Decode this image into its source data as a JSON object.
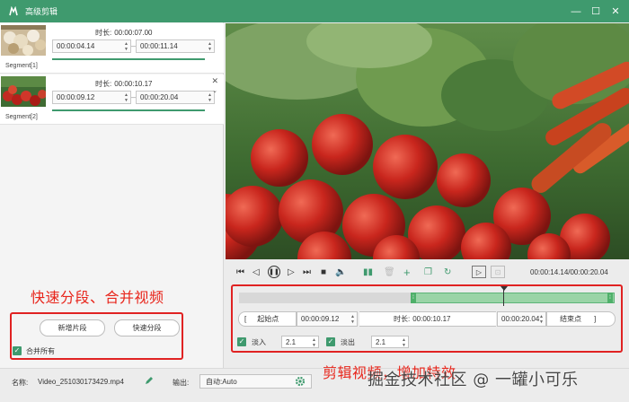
{
  "window": {
    "title": "高级剪辑",
    "controls": {
      "minimize": "—",
      "maximize": "☐",
      "close": "✕"
    }
  },
  "segments": [
    {
      "label": "Segment[1]",
      "duration_label": "时长:",
      "duration": "00:00:07.00",
      "start": "00:00:04.14",
      "end": "00:00:11.14"
    },
    {
      "label": "Segment[2]",
      "duration_label": "时长:",
      "duration": "00:00:10.17",
      "start": "00:00:09.12",
      "end": "00:00:20.04"
    }
  ],
  "segment_ui": {
    "close": "✕",
    "collapse": "⌄",
    "dash": "—"
  },
  "left_actions": {
    "add_segment": "新增片段",
    "quick_split": "快速分段",
    "merge_all": "合并所有",
    "merge_all_checked": true
  },
  "annotations": {
    "left": "快速分段、合并视频",
    "bottom": "剪辑视频，增加特效",
    "watermark": "掘金技术社区 @ 一罐小可乐"
  },
  "player": {
    "timecode": "00:00:14.14/00:00:20.04"
  },
  "trim": {
    "start_label": "起始点",
    "start_bracket": "[",
    "start": "00:00:09.12",
    "duration_label": "时长:",
    "duration": "00:00:10.17",
    "end": "00:00:20.04",
    "end_label": "结束点",
    "end_bracket": "]",
    "selection_start": 0.465,
    "selection_end": 1.0,
    "playhead": 0.7
  },
  "fade": {
    "in_label": "淡入",
    "in_value": "2.1",
    "out_label": "淡出",
    "out_value": "2.1",
    "in_checked": true,
    "out_checked": true
  },
  "bottom": {
    "name_label": "名称:",
    "file_name": "Video_251030173429.mp4",
    "output_label": "输出:",
    "output_value": "自动:Auto"
  },
  "colors": {
    "accent": "#3f9a6e",
    "annotation": "#e8261c",
    "timeline_sel": "#9ad4a7"
  }
}
